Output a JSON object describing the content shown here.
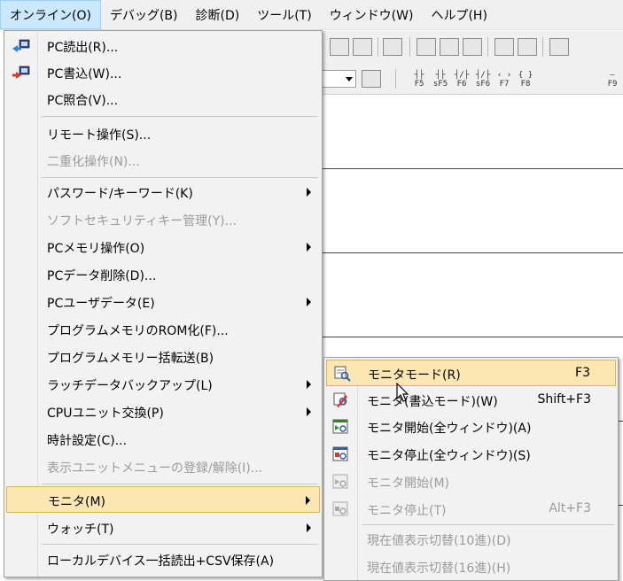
{
  "menubar": [
    {
      "label": "オンライン(O)",
      "active": true
    },
    {
      "label": "デバッグ(B)"
    },
    {
      "label": "診断(D)"
    },
    {
      "label": "ツール(T)"
    },
    {
      "label": "ウィンドウ(W)"
    },
    {
      "label": "ヘルプ(H)"
    }
  ],
  "toolbar": {
    "fkeys": [
      "F5",
      "sF5",
      "F6",
      "sF6",
      "F7",
      "F8",
      "F9"
    ]
  },
  "online_menu": {
    "items": [
      {
        "label": "PC読出(R)...",
        "icon": "pc-read-icon"
      },
      {
        "label": "PC書込(W)...",
        "icon": "pc-write-icon"
      },
      {
        "label": "PC照合(V)..."
      },
      {
        "label": "リモート操作(S)..."
      },
      {
        "label": "二重化操作(N)...",
        "disabled": true
      },
      {
        "label": "パスワード/キーワード(K)",
        "submenu": true
      },
      {
        "label": "ソフトセキュリティキー管理(Y)...",
        "disabled": true
      },
      {
        "label": "PCメモリ操作(O)",
        "submenu": true
      },
      {
        "label": "PCデータ削除(D)..."
      },
      {
        "label": "PCユーザデータ(E)",
        "submenu": true
      },
      {
        "label": "プログラムメモリのROM化(F)..."
      },
      {
        "label": "プログラムメモリー括転送(B)"
      },
      {
        "label": "ラッチデータバックアップ(L)",
        "submenu": true
      },
      {
        "label": "CPUユニット交換(P)",
        "submenu": true
      },
      {
        "label": "時計設定(C)..."
      },
      {
        "label": "表示ユニットメニューの登録/解除(I)...",
        "disabled": true
      },
      {
        "label": "モニタ(M)",
        "submenu": true,
        "highlight": true
      },
      {
        "label": "ウォッチ(T)",
        "submenu": true
      },
      {
        "label": "ローカルデバイス一括読出+CSV保存(A)"
      }
    ]
  },
  "monitor_submenu": {
    "items": [
      {
        "label": "モニタモード(R)",
        "shortcut": "F3",
        "highlight": true,
        "icon": "monitor-mode-icon"
      },
      {
        "label": "モニタ(書込モード)(W)",
        "shortcut": "Shift+F3",
        "icon": "monitor-write-mode-icon"
      },
      {
        "label": "モニタ開始(全ウィンドウ)(A)",
        "shortcut": "",
        "icon": "monitor-start-all-icon"
      },
      {
        "label": "モニタ停止(全ウィンドウ)(S)",
        "shortcut": "",
        "icon": "monitor-stop-all-icon"
      },
      {
        "label": "モニタ開始(M)",
        "shortcut": "",
        "disabled": true,
        "icon": "monitor-start-icon"
      },
      {
        "label": "モニタ停止(T)",
        "shortcut": "Alt+F3",
        "disabled": true,
        "icon": "monitor-stop-icon"
      },
      {
        "label": "現在値表示切替(10進)(D)",
        "shortcut": "",
        "disabled": true
      },
      {
        "label": "現在値表示切替(16進)(H)",
        "shortcut": "",
        "disabled": true
      }
    ]
  },
  "colors": {
    "menu_bg": "#f2f2f2",
    "highlight_bg": "#fce7b2",
    "highlight_border": "#e0b453",
    "menubar_active_bg": "#cce8ff",
    "disabled_text": "#9b9b9b"
  }
}
